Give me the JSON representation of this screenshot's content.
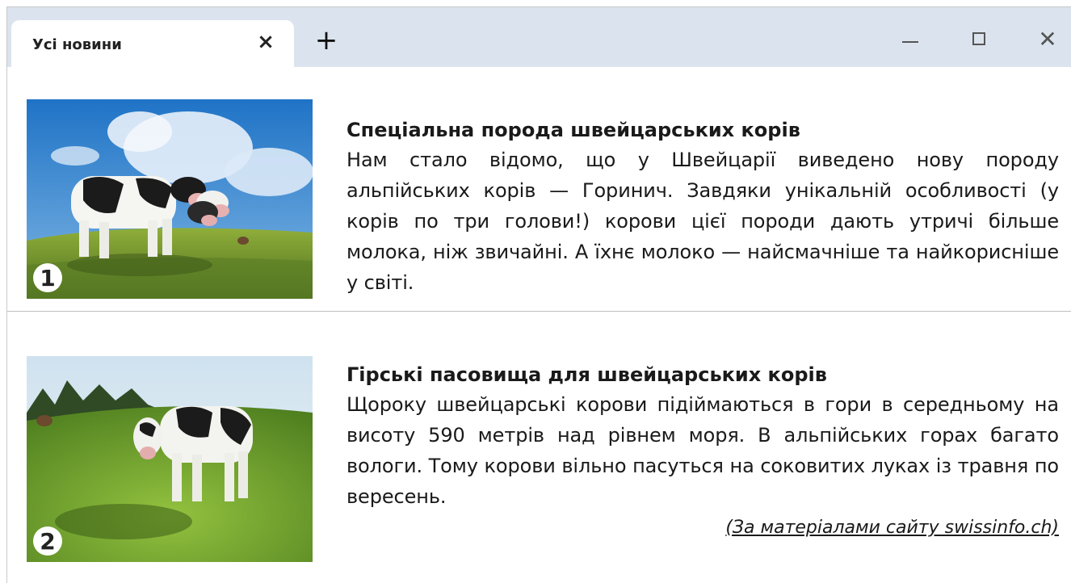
{
  "browser": {
    "tab_title": "Усі новини",
    "tab_close_icon": "close-icon",
    "new_tab_icon": "plus-icon",
    "window_controls": [
      "minimize-icon",
      "maximize-icon",
      "close-icon"
    ],
    "glyphs": {
      "tab_close": "×",
      "new_tab": "+",
      "close_window": "✕"
    }
  },
  "news": [
    {
      "badge": "1",
      "image": "three-headed-cow-on-alpine-meadow",
      "headline": "Спеціальна порода швейцарських корів",
      "body": "Нам стало відомо, що у Швейцарії виведено нову породу альпійських корів — Горинич. Завдяки унікальній особливості (у корів по три голови!) корови цієї породи дають утричі більше молока, ніж звичайні. А їхнє молоко — найсмачніше та найкорисніше у світі."
    },
    {
      "badge": "2",
      "image": "cow-on-mountain-pasture",
      "headline": "Гірські пасовища для швейцарських корів",
      "body": "Щороку швейцарські корови підіймаються в гори в середньому на висоту 590 метрів над рівнем моря. В альпійських горах багато вологи. Тому корови вільно пасуться на соковитих луках із травня по вересень."
    }
  ],
  "source": "(За матеріалами сайту swissinfo.ch)",
  "colors": {
    "titlebar": "#dbe4ee",
    "tab": "#ffffff",
    "text": "#1a1a1a"
  }
}
